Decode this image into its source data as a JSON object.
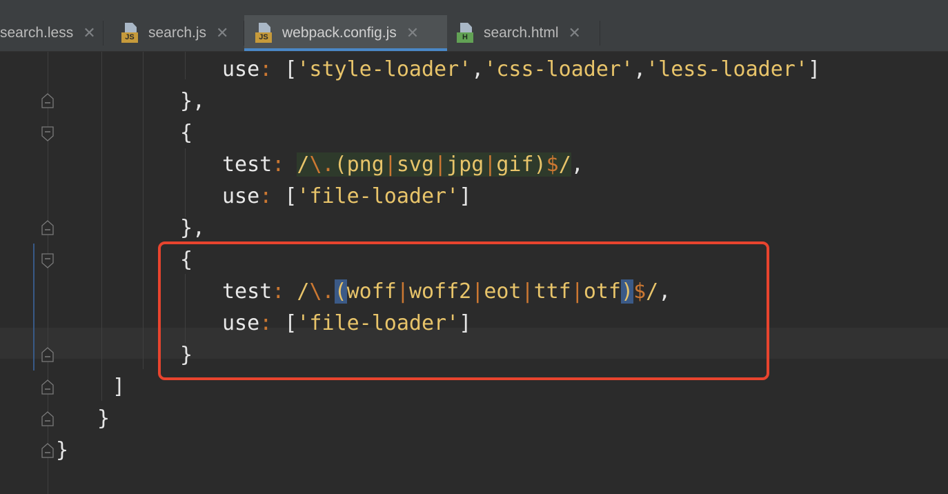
{
  "tabs": [
    {
      "label": "search.less",
      "icon": null,
      "active": false
    },
    {
      "label": "search.js",
      "icon": "js-file-icon",
      "badge": "JS",
      "active": false
    },
    {
      "label": "webpack.config.js",
      "icon": "js-file-icon",
      "badge": "JS",
      "active": true
    },
    {
      "label": "search.html",
      "icon": "html-file-icon",
      "badge": "H",
      "active": false
    }
  ],
  "close_glyph": "✕",
  "code": {
    "line1": {
      "key": "use",
      "colon": ":",
      "open": "[",
      "s1": "'style-loader'",
      "c1": ",",
      "s2": "'css-loader'",
      "c2": ",",
      "s3": "'less-loader'",
      "close": "]"
    },
    "line2": "},",
    "line3": "{",
    "line4": {
      "key": "test",
      "colon": ":",
      "slash1": "/",
      "esc": "\\.",
      "lp": "(",
      "a": "png",
      "p1": "|",
      "b": "svg",
      "p2": "|",
      "c": "jpg",
      "p3": "|",
      "d": "gif",
      "rp": ")",
      "anchor": "$",
      "slash2": "/",
      "comma": ","
    },
    "line5": {
      "key": "use",
      "colon": ":",
      "open": "[",
      "s1": "'file-loader'",
      "close": "]"
    },
    "line6": "},",
    "line7": "{",
    "line8": {
      "key": "test",
      "colon": ":",
      "slash1": "/",
      "esc": "\\.",
      "lp": "(",
      "a": "woff",
      "p1": "|",
      "b": "woff2",
      "p2": "|",
      "c": "eot",
      "p3": "|",
      "d": "ttf",
      "p4": "|",
      "e": "otf",
      "rp": ")",
      "anchor": "$",
      "slash2": "/",
      "comma": ","
    },
    "line9": {
      "key": "use",
      "colon": ":",
      "open": "[",
      "s1": "'file-loader'",
      "close": "]"
    },
    "line10": "}",
    "line11": "]",
    "line12": "}",
    "line13": "}"
  },
  "colors": {
    "annotation_box": "#e8442e",
    "active_tab_underline": "#4a88c7",
    "string": "#e8c46a",
    "regex_operator": "#cc7832"
  }
}
